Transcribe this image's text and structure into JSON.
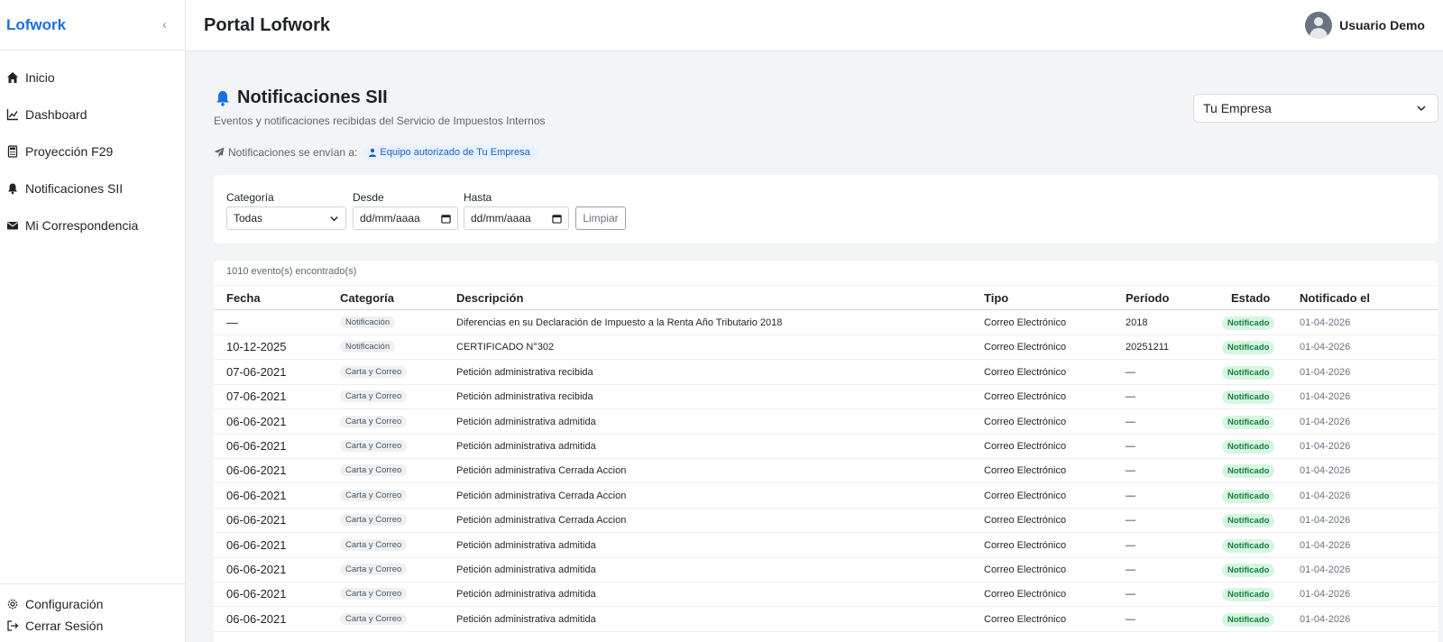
{
  "sidebar": {
    "brand": "Lofwork",
    "collapse_icon": "chevron-left-icon",
    "items": [
      {
        "label": "Inicio",
        "icon": "home-icon"
      },
      {
        "label": "Dashboard",
        "icon": "chart-line-icon"
      },
      {
        "label": "Proyección F29",
        "icon": "calculator-icon"
      },
      {
        "label": "Notificaciones SII",
        "icon": "bell-icon"
      },
      {
        "label": "Mi Correspondencia",
        "icon": "envelope-icon"
      }
    ],
    "bottom": [
      {
        "label": "Configuración",
        "icon": "gear-icon"
      },
      {
        "label": "Cerrar Sesión",
        "icon": "logout-icon"
      }
    ]
  },
  "header": {
    "title": "Portal Lofwork",
    "user_name": "Usuario Demo"
  },
  "page": {
    "title": "Notificaciones SII",
    "subtitle": "Eventos y notificaciones recibidas del Servicio de Impuestos Internos",
    "company_select": "Tu Empresa",
    "recipients_label": "Notificaciones se envían a:",
    "recipients_value": "Equipo autorizado de Tu Empresa"
  },
  "filters": {
    "category_label": "Categoría",
    "category_value": "Todas",
    "from_label": "Desde",
    "from_value": "dd/mm/aaaa",
    "to_label": "Hasta",
    "to_value": "dd/mm/aaaa",
    "clear_label": "Limpiar"
  },
  "results": {
    "count_text": "1010 evento(s) encontrado(s)",
    "columns": [
      "Fecha",
      "Categoría",
      "Descripción",
      "Tipo",
      "Período",
      "Estado",
      "Notificado el"
    ],
    "rows": [
      {
        "fecha": "—",
        "categoria": "Notificación",
        "descripcion": "Diferencias en su Declaración de Impuesto a la Renta Año Tributario 2018",
        "tipo": "Correo Electrónico",
        "periodo": "2018",
        "estado": "Notificado",
        "notificado": "01-04-2026"
      },
      {
        "fecha": "10-12-2025",
        "categoria": "Notificación",
        "descripcion": "CERTIFICADO N°302",
        "tipo": "Correo Electrónico",
        "periodo": "20251211",
        "estado": "Notificado",
        "notificado": "01-04-2026"
      },
      {
        "fecha": "07-06-2021",
        "categoria": "Carta y Correo",
        "descripcion": "Petición administrativa recibida",
        "tipo": "Correo Electrónico",
        "periodo": "—",
        "estado": "Notificado",
        "notificado": "01-04-2026"
      },
      {
        "fecha": "07-06-2021",
        "categoria": "Carta y Correo",
        "descripcion": "Petición administrativa recibida",
        "tipo": "Correo Electrónico",
        "periodo": "—",
        "estado": "Notificado",
        "notificado": "01-04-2026"
      },
      {
        "fecha": "06-06-2021",
        "categoria": "Carta y Correo",
        "descripcion": "Petición administrativa admitida",
        "tipo": "Correo Electrónico",
        "periodo": "—",
        "estado": "Notificado",
        "notificado": "01-04-2026"
      },
      {
        "fecha": "06-06-2021",
        "categoria": "Carta y Correo",
        "descripcion": "Petición administrativa admitida",
        "tipo": "Correo Electrónico",
        "periodo": "—",
        "estado": "Notificado",
        "notificado": "01-04-2026"
      },
      {
        "fecha": "06-06-2021",
        "categoria": "Carta y Correo",
        "descripcion": "Petición administrativa Cerrada Accion",
        "tipo": "Correo Electrónico",
        "periodo": "—",
        "estado": "Notificado",
        "notificado": "01-04-2026"
      },
      {
        "fecha": "06-06-2021",
        "categoria": "Carta y Correo",
        "descripcion": "Petición administrativa Cerrada Accion",
        "tipo": "Correo Electrónico",
        "periodo": "—",
        "estado": "Notificado",
        "notificado": "01-04-2026"
      },
      {
        "fecha": "06-06-2021",
        "categoria": "Carta y Correo",
        "descripcion": "Petición administrativa Cerrada Accion",
        "tipo": "Correo Electrónico",
        "periodo": "—",
        "estado": "Notificado",
        "notificado": "01-04-2026"
      },
      {
        "fecha": "06-06-2021",
        "categoria": "Carta y Correo",
        "descripcion": "Petición administrativa admitida",
        "tipo": "Correo Electrónico",
        "periodo": "—",
        "estado": "Notificado",
        "notificado": "01-04-2026"
      },
      {
        "fecha": "06-06-2021",
        "categoria": "Carta y Correo",
        "descripcion": "Petición administrativa admitida",
        "tipo": "Correo Electrónico",
        "periodo": "—",
        "estado": "Notificado",
        "notificado": "01-04-2026"
      },
      {
        "fecha": "06-06-2021",
        "categoria": "Carta y Correo",
        "descripcion": "Petición administrativa admitida",
        "tipo": "Correo Electrónico",
        "periodo": "—",
        "estado": "Notificado",
        "notificado": "01-04-2026"
      },
      {
        "fecha": "06-06-2021",
        "categoria": "Carta y Correo",
        "descripcion": "Petición administrativa admitida",
        "tipo": "Correo Electrónico",
        "periodo": "—",
        "estado": "Notificado",
        "notificado": "01-04-2026"
      }
    ]
  },
  "colors": {
    "brand": "#1a6fe3",
    "badge_bg": "#d6f5e2",
    "badge_text": "#16803d",
    "pill_bg": "#e8f1fd"
  }
}
